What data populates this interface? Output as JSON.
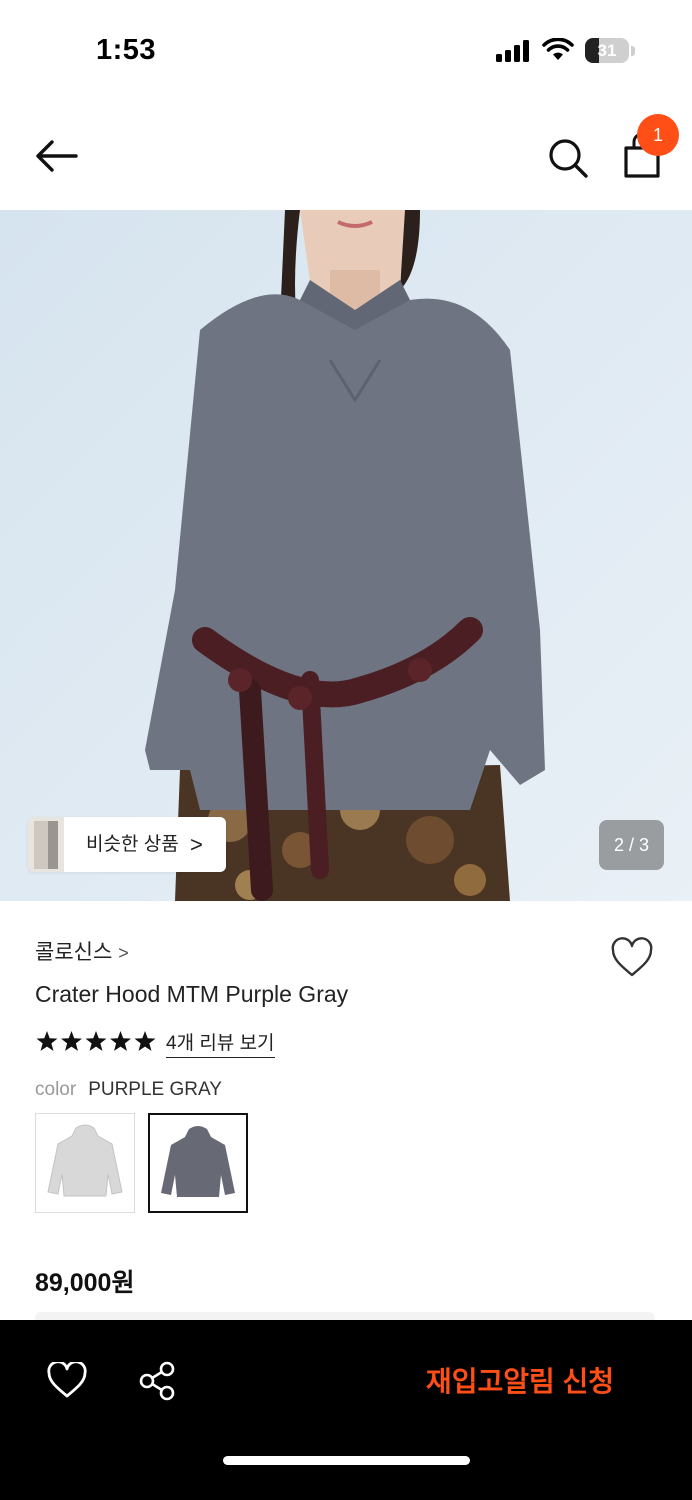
{
  "status_bar": {
    "time": "1:53",
    "battery_level": "31",
    "battery_fraction": 0.31,
    "icons": [
      "signal-icon",
      "wifi-icon",
      "battery-icon"
    ]
  },
  "nav": {
    "back_icon": "arrow-left-icon",
    "search_icon": "search-icon",
    "bag_icon": "shopping-bag-icon",
    "cart_count": "1"
  },
  "gallery": {
    "image_subject": "Model wearing purple gray hooded sweatshirt with braided burgundy belt and floral skirt",
    "similar_label": "비슷한 상품",
    "similar_chevron": ">",
    "page_indicator": "2 / 3"
  },
  "product": {
    "brand": "콜로신스",
    "brand_chevron": ">",
    "name": "Crater Hood MTM Purple Gray",
    "rating_stars": 5,
    "review_link": "4개 리뷰 보기",
    "color_key": "color",
    "color_value": "PURPLE GRAY",
    "color_options": [
      "light gray hoodie",
      "purple gray hoodie"
    ],
    "selected_color_index": 1,
    "price": "89,000원"
  },
  "bottom_bar": {
    "wishlist_icon": "heart-icon",
    "share_icon": "share-icon",
    "restock_label": "재입고알림 신청"
  },
  "colors": {
    "accent": "#ff4e16",
    "bottom_bar_bg": "#000000",
    "hoodie": "#6f7482",
    "background_sky": "#dfe9f1"
  }
}
